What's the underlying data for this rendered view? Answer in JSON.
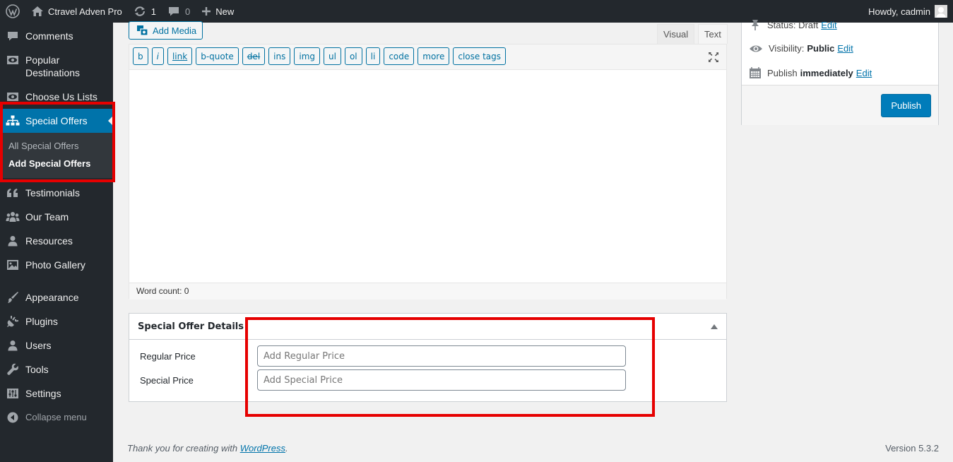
{
  "adminbar": {
    "site_name": "Ctravel Adven Pro",
    "updates_count": "1",
    "comments_count": "0",
    "new_label": "New",
    "howdy": "Howdy, cadmin"
  },
  "menu": {
    "comments": "Comments",
    "popular_destinations_1": "Popular",
    "popular_destinations_2": "Destinations",
    "choose_us": "Choose Us Lists",
    "special_offers": "Special Offers",
    "all_special_offers": "All Special Offers",
    "add_special_offers": "Add Special Offers",
    "testimonials": "Testimonials",
    "our_team": "Our Team",
    "resources": "Resources",
    "photo_gallery": "Photo Gallery",
    "appearance": "Appearance",
    "plugins": "Plugins",
    "users": "Users",
    "tools": "Tools",
    "settings": "Settings",
    "collapse": "Collapse menu"
  },
  "editor": {
    "add_media": "Add Media",
    "tab_visual": "Visual",
    "tab_text": "Text",
    "quicktags": [
      "b",
      "i",
      "link",
      "b-quote",
      "del",
      "ins",
      "img",
      "ul",
      "ol",
      "li",
      "code",
      "more",
      "close tags"
    ],
    "word_count": "Word count: 0"
  },
  "metabox": {
    "title": "Special Offer Details",
    "regular_label": "Regular Price",
    "regular_placeholder": "Add Regular Price",
    "special_label": "Special Price",
    "special_placeholder": "Add Special Price"
  },
  "publish": {
    "status_label": "Status: Draft",
    "visibility_label": "Visibility:",
    "visibility_value": "Public",
    "publish_label": "Publish",
    "publish_value": "immediately",
    "edit_link": "Edit",
    "publish_button": "Publish"
  },
  "footer": {
    "thanks_prefix": "Thank you for creating with ",
    "thanks_link": "WordPress",
    "thanks_suffix": ".",
    "version": "Version 5.3.2"
  },
  "colors": {
    "highlight": "#e60000",
    "accent": "#0073aa",
    "menu_bg": "#23282d"
  }
}
